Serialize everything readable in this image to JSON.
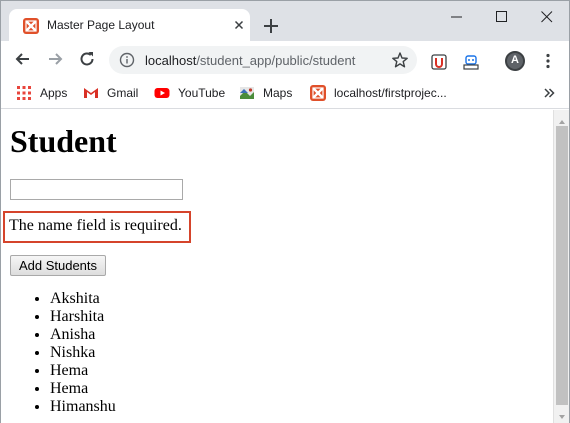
{
  "browser": {
    "tab_title": "Master Page Layout",
    "url_host": "localhost",
    "url_path": "/student_app/public/student",
    "avatar_letter": "A"
  },
  "bookmarks": [
    {
      "label": "Apps",
      "icon": "apps-grid-icon"
    },
    {
      "label": "Gmail",
      "icon": "gmail-icon"
    },
    {
      "label": "YouTube",
      "icon": "youtube-icon"
    },
    {
      "label": "Maps",
      "icon": "maps-icon"
    },
    {
      "label": "localhost/firstprojec...",
      "icon": "xampp-icon"
    }
  ],
  "page": {
    "title": "Student",
    "name_input_value": "",
    "error_message": "The name field is required.",
    "add_button_label": "Add Students",
    "students": [
      "Akshita",
      "Harshita",
      "Anisha",
      "Nishka",
      "Hema",
      "Hema",
      "Himanshu"
    ]
  },
  "colors": {
    "error_border": "#d5442b",
    "tabstrip_bg": "#dee1e6",
    "xampp_orange": "#e0502a"
  }
}
